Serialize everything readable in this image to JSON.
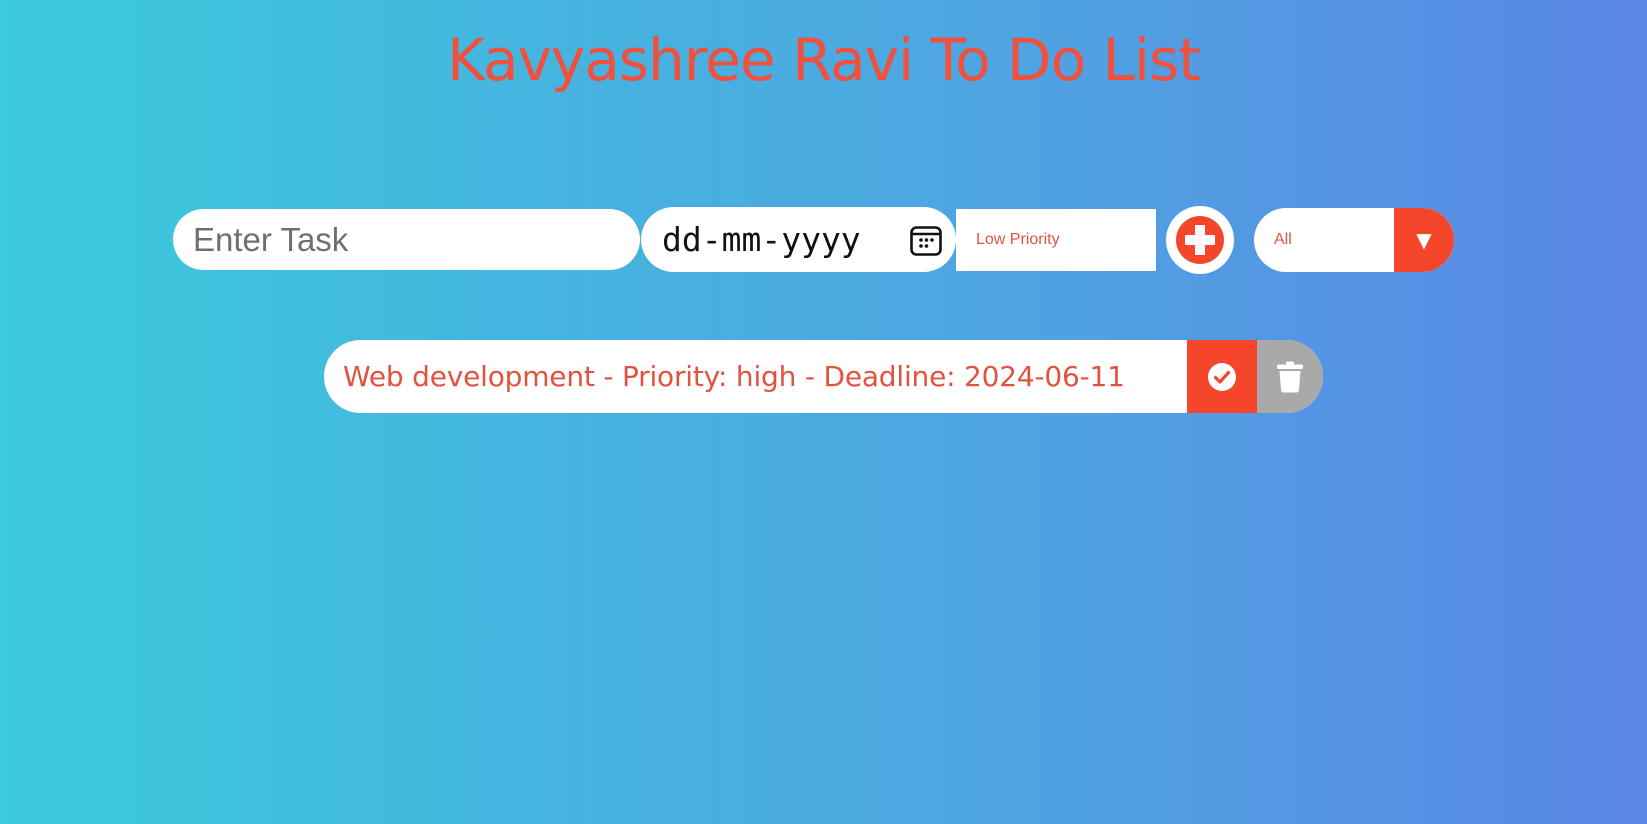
{
  "header": {
    "title": "Kavyashree Ravi To Do List"
  },
  "form": {
    "task_placeholder": "Enter Task",
    "task_value": "",
    "date_placeholder": "dd-mm-yyyy",
    "date_icon": "calendar-icon",
    "priority_selected": "Low Priority",
    "add_icon": "plus-circle-icon",
    "filter_selected": "All",
    "filter_arrow": "▼"
  },
  "tasks": [
    {
      "text": "Web development - Priority: high - Deadline: 2024-06-11",
      "complete_icon": "check-circle-icon",
      "delete_icon": "trash-icon"
    }
  ],
  "colors": {
    "accent": "#f5462c",
    "text_accent": "#e2533f",
    "delete_bg": "#a9a9a9",
    "gradient_start": "#3bcbdb",
    "gradient_end": "#5a86e5"
  }
}
